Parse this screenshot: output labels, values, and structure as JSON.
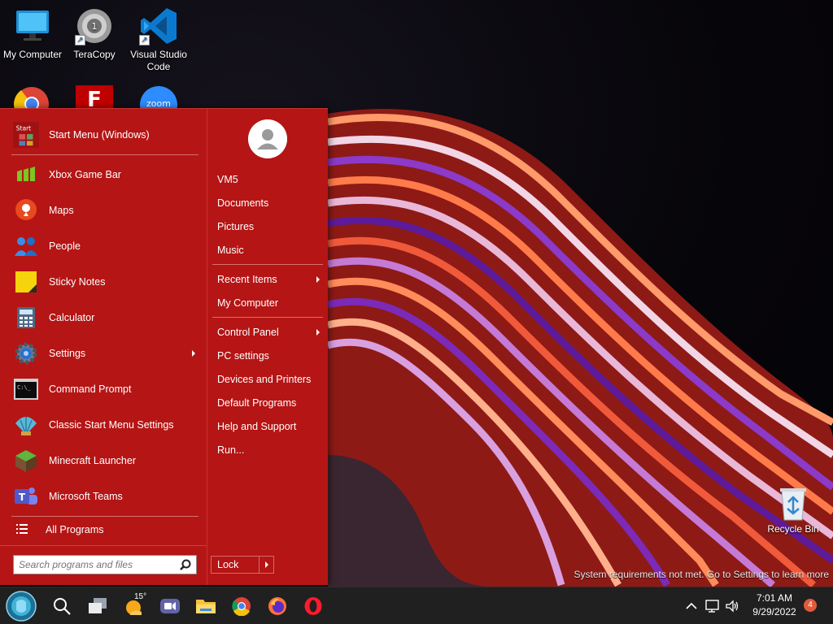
{
  "desktop": {
    "icons": [
      {
        "label": "My Computer"
      },
      {
        "label": "TeraCopy"
      },
      {
        "label": "Visual Studio Code"
      }
    ],
    "recycle_bin": {
      "label": "Recycle Bin"
    },
    "watermark": "System requirements not met. Go to Settings to learn more"
  },
  "start_menu": {
    "pinned_header": {
      "label": "Start Menu (Windows)",
      "icon_text": "Start"
    },
    "apps": [
      {
        "label": "Xbox Game Bar"
      },
      {
        "label": "Maps"
      },
      {
        "label": "People"
      },
      {
        "label": "Sticky Notes"
      },
      {
        "label": "Calculator"
      },
      {
        "label": "Settings"
      },
      {
        "label": "Command Prompt",
        "icon_text": "C:\\_"
      },
      {
        "label": "Classic Start Menu Settings"
      },
      {
        "label": "Minecraft Launcher"
      },
      {
        "label": "Microsoft Teams"
      }
    ],
    "all_programs": "All Programs",
    "search_placeholder": "Search programs and files",
    "right": {
      "user": "VM5",
      "documents": "Documents",
      "pictures": "Pictures",
      "music": "Music",
      "recent_items": "Recent Items",
      "my_computer": "My Computer",
      "control_panel": "Control Panel",
      "pc_settings": "PC settings",
      "devices_printers": "Devices and Printers",
      "default_programs": "Default Programs",
      "help_support": "Help and Support",
      "run": "Run...",
      "lock": "Lock"
    }
  },
  "taskbar": {
    "weather_temp": "15°",
    "time": "7:01 AM",
    "date": "9/29/2022",
    "notification_count": "4"
  },
  "colors": {
    "start_menu_bg": "#b51515",
    "taskbar_bg": "#202020",
    "separator": "#d9716f"
  }
}
